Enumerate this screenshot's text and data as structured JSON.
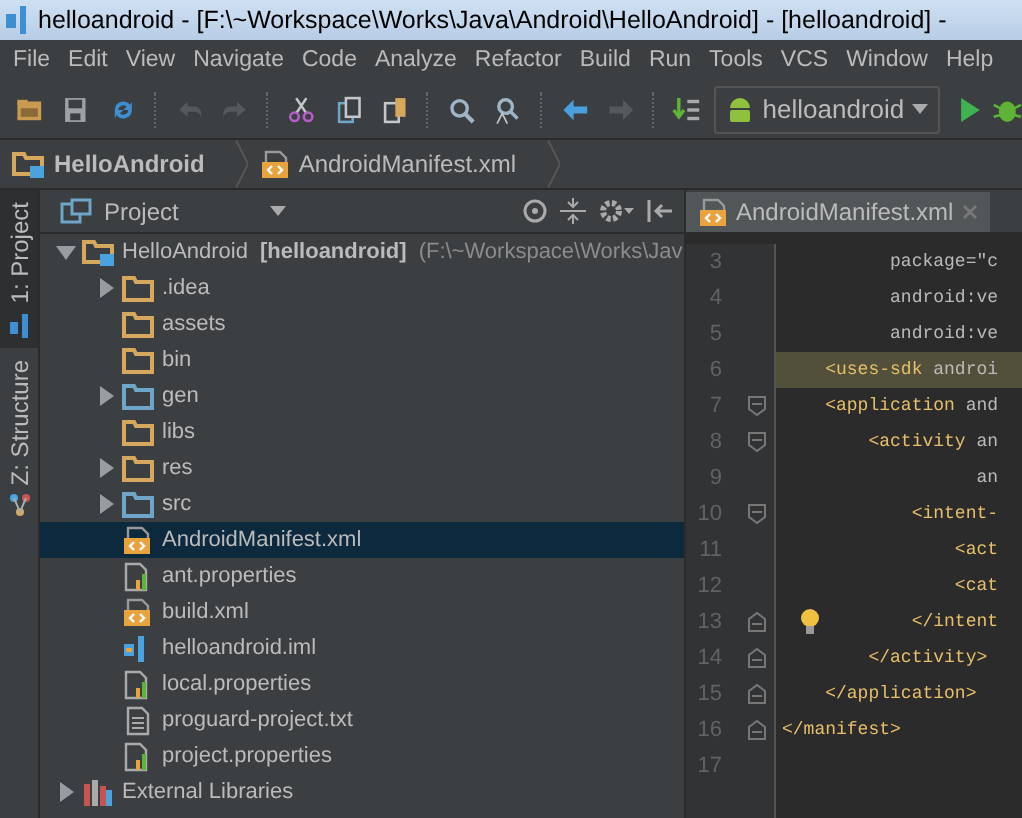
{
  "window": {
    "title": "helloandroid - [F:\\~Workspace\\Works\\Java\\Android\\HelloAndroid] - [helloandroid] -"
  },
  "menu": [
    "File",
    "Edit",
    "View",
    "Navigate",
    "Code",
    "Analyze",
    "Refactor",
    "Build",
    "Run",
    "Tools",
    "VCS",
    "Window",
    "Help"
  ],
  "toolbar": {
    "buttons": [
      {
        "kind": "open",
        "disabled": false
      },
      {
        "kind": "save",
        "disabled": false
      },
      {
        "kind": "sync",
        "disabled": false
      },
      {
        "kind": "sep"
      },
      {
        "kind": "undo",
        "disabled": true
      },
      {
        "kind": "redo",
        "disabled": true
      },
      {
        "kind": "sep"
      },
      {
        "kind": "cut",
        "disabled": false
      },
      {
        "kind": "copy",
        "disabled": false
      },
      {
        "kind": "paste",
        "disabled": false
      },
      {
        "kind": "sep"
      },
      {
        "kind": "find",
        "disabled": false
      },
      {
        "kind": "replace",
        "disabled": false
      },
      {
        "kind": "sep"
      },
      {
        "kind": "back",
        "disabled": false
      },
      {
        "kind": "forward",
        "disabled": true
      },
      {
        "kind": "sep"
      },
      {
        "kind": "make",
        "disabled": false
      }
    ],
    "run_config": "helloandroid"
  },
  "breadcrumb": [
    {
      "label": "HelloAndroid",
      "kind": "module"
    },
    {
      "label": "AndroidManifest.xml",
      "kind": "xml"
    }
  ],
  "side_tabs": [
    {
      "label": "1: Project",
      "selected": true
    },
    {
      "label": "Z: Structure",
      "selected": false
    }
  ],
  "project": {
    "title": "Project",
    "tree": [
      {
        "name": "HelloAndroid",
        "module": "[helloandroid]",
        "path": "(F:\\~Workspace\\Works\\Jav",
        "kind": "module",
        "expanded": true,
        "selected": false,
        "children": [
          {
            "name": ".idea",
            "kind": "folder",
            "expanded": false,
            "selected": false
          },
          {
            "name": "assets",
            "kind": "folder",
            "selected": false
          },
          {
            "name": "bin",
            "kind": "folder",
            "selected": false
          },
          {
            "name": "gen",
            "kind": "source",
            "expanded": false,
            "selected": false
          },
          {
            "name": "libs",
            "kind": "folder",
            "selected": false
          },
          {
            "name": "res",
            "kind": "folder",
            "expanded": false,
            "selected": false
          },
          {
            "name": "src",
            "kind": "source",
            "expanded": false,
            "selected": false
          },
          {
            "name": "AndroidManifest.xml",
            "kind": "xml",
            "selected": true
          },
          {
            "name": "ant.properties",
            "kind": "properties",
            "selected": false
          },
          {
            "name": "build.xml",
            "kind": "xml",
            "selected": false
          },
          {
            "name": "helloandroid.iml",
            "kind": "iml",
            "selected": false
          },
          {
            "name": "local.properties",
            "kind": "properties",
            "selected": false
          },
          {
            "name": "proguard-project.txt",
            "kind": "text",
            "selected": false
          },
          {
            "name": "project.properties",
            "kind": "properties",
            "selected": false
          }
        ]
      },
      {
        "name": "External Libraries",
        "kind": "library",
        "expanded": false,
        "selected": false
      }
    ]
  },
  "editor": {
    "tab": "AndroidManifest.xml",
    "lines": [
      {
        "number": "3",
        "text": "          package=\"c"
      },
      {
        "number": "4",
        "text": "          android:ve"
      },
      {
        "number": "5",
        "text": "          android:ve"
      },
      {
        "number": "6",
        "tag": "    <uses-sdk",
        "text": " androi",
        "highlighted": true
      },
      {
        "number": "7",
        "tag": "    <application",
        "text": " and",
        "fold_start": true
      },
      {
        "number": "8",
        "tag": "        <activity",
        "text": " an",
        "fold_start": true
      },
      {
        "number": "9",
        "text": "                  an"
      },
      {
        "number": "10",
        "tag": "            <intent-",
        "fold_start": true
      },
      {
        "number": "11",
        "tag": "                <act"
      },
      {
        "number": "12",
        "tag": "                <cat"
      },
      {
        "number": "13",
        "tag": "            </intent",
        "fold_end": true,
        "hint": true
      },
      {
        "number": "14",
        "tag": "        </activity>",
        "fold_end": true
      },
      {
        "number": "15",
        "tag": "    </application>",
        "fold_end": true
      },
      {
        "number": "16",
        "tag": "</manifest>",
        "fold_end": true
      },
      {
        "number": "17"
      }
    ]
  }
}
